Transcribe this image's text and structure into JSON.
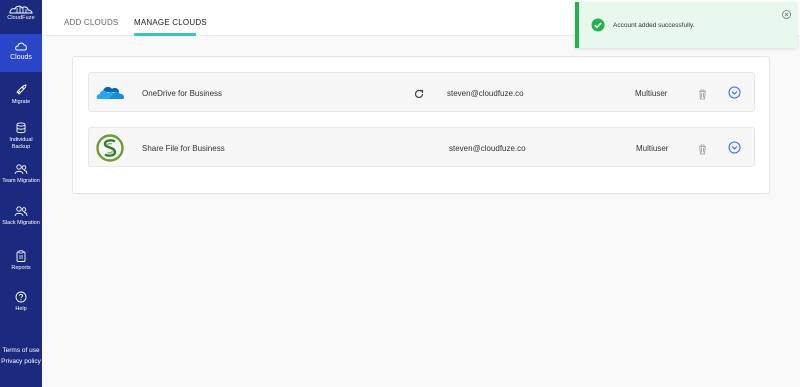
{
  "sidebar": {
    "logo_text": "CloudFuze",
    "items": [
      {
        "label": "Clouds",
        "icon": "cloud-icon",
        "active": true
      },
      {
        "label": "Migrate",
        "icon": "rocket-icon"
      },
      {
        "label": "Individual Backup",
        "icon": "database-icon"
      },
      {
        "label": "Team Migration",
        "icon": "users-icon"
      },
      {
        "label": "Slack Migration",
        "icon": "users-icon"
      },
      {
        "label": "Reports",
        "icon": "clipboard-icon"
      },
      {
        "label": "Help",
        "icon": "help-icon"
      }
    ],
    "footer": {
      "terms": "Terms of use",
      "privacy": "Privacy policy"
    }
  },
  "tabs": [
    {
      "label": "ADD CLOUDS"
    },
    {
      "label": "MANAGE CLOUDS",
      "active": true
    }
  ],
  "toast": {
    "message": "Account added successfully."
  },
  "clouds": [
    {
      "name": "OneDrive for Business",
      "email": "steven@cloudfuze.co",
      "user_type": "Multiuser",
      "logo": "onedrive-logo",
      "syncing": true
    },
    {
      "name": "Share File for Business",
      "email": "steven@cloudfuze.co",
      "user_type": "Multiuser",
      "logo": "sharefile-logo",
      "syncing": false
    }
  ],
  "colors": {
    "sidebar": "#1b2a7e",
    "active_nav": "#2a46c8",
    "tab_accent": "#35c3c9",
    "success": "#22b14c",
    "chevron": "#2e6fd8"
  }
}
